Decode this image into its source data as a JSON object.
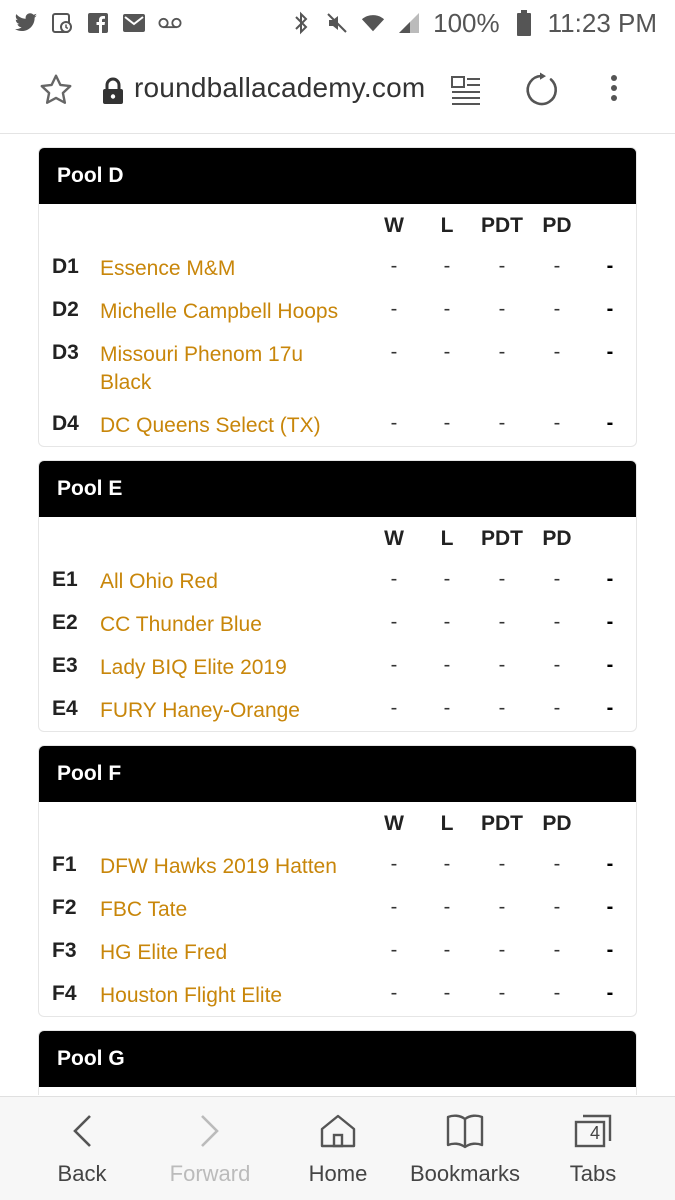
{
  "status_bar": {
    "battery_percent": "100%",
    "time": "11:23 PM",
    "left_icons": [
      "twitter-icon",
      "calendar-icon",
      "facebook-icon",
      "mail-icon",
      "voicemail-icon"
    ],
    "right_icons": [
      "bluetooth-icon",
      "mute-icon",
      "wifi-icon",
      "signal-icon",
      "battery-icon"
    ]
  },
  "address_bar": {
    "url": "roundballacademy.com"
  },
  "columns": [
    "W",
    "L",
    "PDT",
    "PD"
  ],
  "pools": [
    {
      "title": "Pool D",
      "teams": [
        {
          "seed": "D1",
          "name": "Essence M&M",
          "stats": [
            "-",
            "-",
            "-",
            "-",
            "-"
          ]
        },
        {
          "seed": "D2",
          "name": "Michelle Campbell Hoops",
          "stats": [
            "-",
            "-",
            "-",
            "-",
            "-"
          ]
        },
        {
          "seed": "D3",
          "name": "Missouri Phenom 17u Black",
          "stats": [
            "-",
            "-",
            "-",
            "-",
            "-"
          ]
        },
        {
          "seed": "D4",
          "name": "DC Queens Select (TX)",
          "stats": [
            "-",
            "-",
            "-",
            "-",
            "-"
          ]
        }
      ]
    },
    {
      "title": "Pool E",
      "teams": [
        {
          "seed": "E1",
          "name": "All Ohio Red",
          "stats": [
            "-",
            "-",
            "-",
            "-",
            "-"
          ]
        },
        {
          "seed": "E2",
          "name": "CC Thunder Blue",
          "stats": [
            "-",
            "-",
            "-",
            "-",
            "-"
          ]
        },
        {
          "seed": "E3",
          "name": "Lady BIQ Elite 2019",
          "stats": [
            "-",
            "-",
            "-",
            "-",
            "-"
          ]
        },
        {
          "seed": "E4",
          "name": "FURY Haney-Orange",
          "stats": [
            "-",
            "-",
            "-",
            "-",
            "-"
          ]
        }
      ]
    },
    {
      "title": "Pool F",
      "teams": [
        {
          "seed": "F1",
          "name": "DFW Hawks 2019 Hatten",
          "stats": [
            "-",
            "-",
            "-",
            "-",
            "-"
          ]
        },
        {
          "seed": "F2",
          "name": "FBC Tate",
          "stats": [
            "-",
            "-",
            "-",
            "-",
            "-"
          ]
        },
        {
          "seed": "F3",
          "name": "HG Elite Fred",
          "stats": [
            "-",
            "-",
            "-",
            "-",
            "-"
          ]
        },
        {
          "seed": "F4",
          "name": "Houston Flight Elite",
          "stats": [
            "-",
            "-",
            "-",
            "-",
            "-"
          ]
        }
      ]
    },
    {
      "title": "Pool G",
      "teams": []
    }
  ],
  "bottom_nav": {
    "back": "Back",
    "forward": "Forward",
    "home": "Home",
    "bookmarks": "Bookmarks",
    "tabs": "Tabs",
    "tab_count": "4"
  },
  "colors": {
    "team_link": "#c8860a",
    "pool_header_bg": "#000000",
    "pool_header_text": "#ffffff"
  }
}
